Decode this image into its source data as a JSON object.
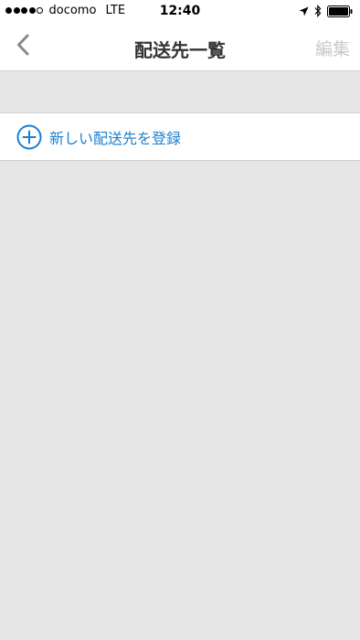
{
  "status_bar": {
    "carrier": "docomo",
    "network": "LTE",
    "time": "12:40",
    "signal_strength": "4 of 5",
    "icons": [
      "location-arrow-icon",
      "bluetooth-icon",
      "battery-icon"
    ]
  },
  "nav": {
    "back_icon": "chevron-left-icon",
    "title": "配送先一覧",
    "edit_label": "編集"
  },
  "list": {
    "add_icon": "plus-circle-icon",
    "add_label": "新しい配送先を登録"
  },
  "colors": {
    "accent": "#1a7fd0",
    "background": "#e6e6e6",
    "disabled": "#c8c8c8",
    "title": "#333333"
  }
}
